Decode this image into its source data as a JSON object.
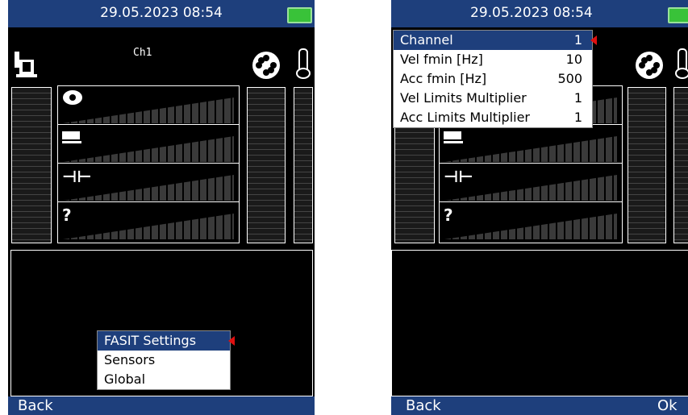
{
  "left": {
    "header": {
      "datetime": "29.05.2023 08:54"
    },
    "channel_label": "Ch1",
    "measure_rows": [
      {
        "icon": "bearing-icon",
        "glyph": ""
      },
      {
        "icon": "machine-icon",
        "glyph": ""
      },
      {
        "icon": "coupling-icon",
        "glyph": "⊣⊢"
      },
      {
        "icon": "unknown-icon",
        "glyph": "?"
      }
    ],
    "menu": {
      "items": [
        {
          "label": "FASIT Settings",
          "selected": true
        },
        {
          "label": "Sensors",
          "selected": false
        },
        {
          "label": "Global",
          "selected": false
        }
      ]
    },
    "footer": {
      "back_label": "Back"
    }
  },
  "right": {
    "header": {
      "datetime": "29.05.2023 08:54"
    },
    "measure_rows": [
      {
        "icon": "machine-icon",
        "glyph": ""
      },
      {
        "icon": "coupling-icon",
        "glyph": "⊣⊢"
      },
      {
        "icon": "unknown-icon",
        "glyph": "?"
      }
    ],
    "settings": {
      "items": [
        {
          "label": "Channel",
          "value": "1",
          "selected": true
        },
        {
          "label": "Vel fmin [Hz]",
          "value": "10",
          "selected": false
        },
        {
          "label": "Acc fmin [Hz]",
          "value": "500",
          "selected": false
        },
        {
          "label": "Vel Limits Multiplier",
          "value": "1",
          "selected": false
        },
        {
          "label": "Acc Limits Multiplier",
          "value": "1",
          "selected": false
        }
      ]
    },
    "footer": {
      "back_label": "Back",
      "ok_label": "Ok"
    }
  },
  "colors": {
    "header_bg": "#1e3f7c",
    "battery": "#39c239",
    "selection_marker": "#e01010"
  }
}
